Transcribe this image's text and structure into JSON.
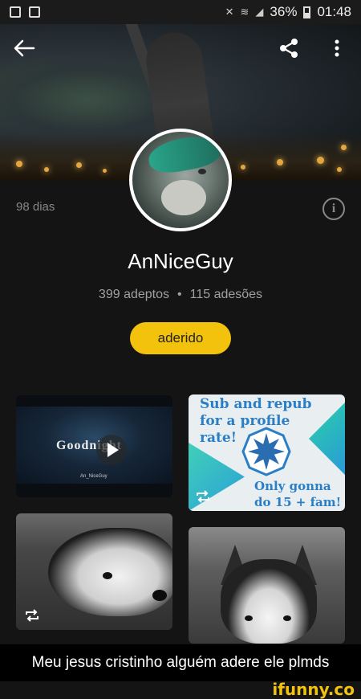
{
  "status_bar": {
    "battery": "36%",
    "time": "01:48"
  },
  "profile": {
    "days": "98 dias",
    "username": "AnNiceGuy",
    "followers": "399 adeptos",
    "separator": "•",
    "memberships": "115 adesões",
    "join_label": "aderido"
  },
  "posts": [
    {
      "type": "video",
      "title": "Goodnight",
      "signature": "An_NiceGuy"
    },
    {
      "type": "repost-image",
      "text_top": "Sub and repub\nfor a profile\nrate!",
      "text_bottom": "Only gonna\ndo 15 + fam!"
    },
    {
      "type": "repost-image"
    },
    {
      "type": "image"
    }
  ],
  "caption": "Meu jesus cristinho alguém adere ele plmds",
  "watermark": "ifunny.co",
  "colors": {
    "accent": "#f3c20d",
    "background": "#141414"
  }
}
